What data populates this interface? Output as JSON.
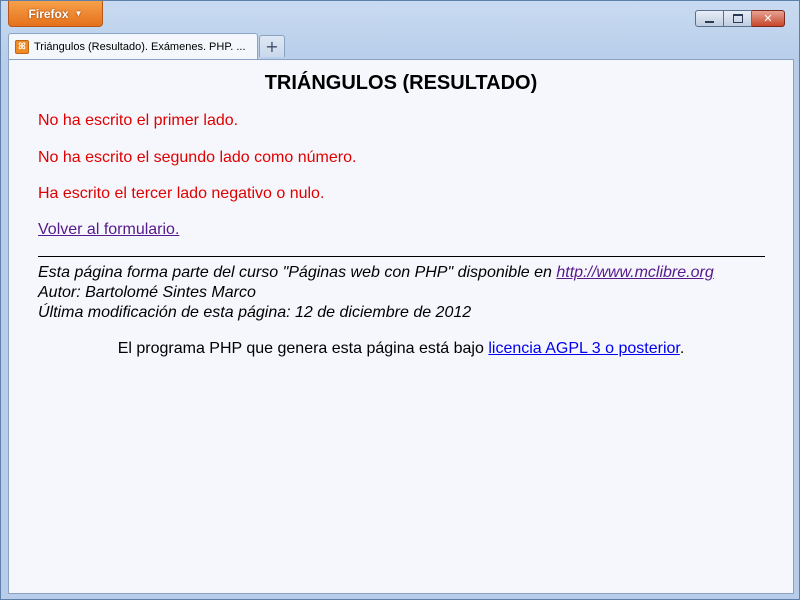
{
  "browser": {
    "menu_button_label": "Firefox",
    "tab_title": "Triángulos (Resultado). Exámenes. PHP. ...",
    "new_tab_label": "+"
  },
  "page": {
    "heading": "TRIÁNGULOS (RESULTADO)",
    "errors": [
      "No ha escrito el primer lado.",
      "No ha escrito el segundo lado como número.",
      "Ha escrito el tercer lado negativo o nulo."
    ],
    "back_link": "Volver al formulario.",
    "footer": {
      "course_text": "Esta página forma parte del curso \"Páginas web con PHP\" disponible en",
      "course_link": "http://www.mclibre.org",
      "author": "Autor: Bartolomé Sintes Marco",
      "last_modified": "Última modificación de esta página: 12 de diciembre de 2012"
    },
    "license": {
      "text": "El programa PHP que genera esta página está bajo",
      "link": "licencia AGPL 3 o posterior",
      "suffix": "."
    }
  },
  "colors": {
    "error": "#e00000",
    "visited_link": "#551a8b",
    "link": "#0000ee",
    "firefox_orange": "#e5711b"
  }
}
